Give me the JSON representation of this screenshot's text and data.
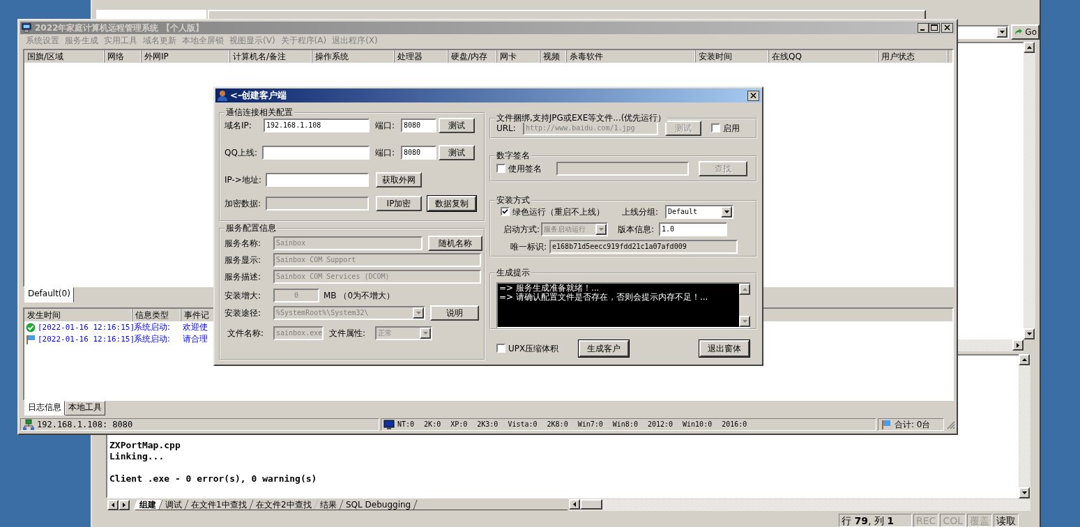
{
  "ide": {
    "go_button": "Go",
    "output": [
      [
        "ZXPortMap.cpp",
        "Linking..."
      ],
      [
        "Client .exe - 0 error(s), 0 warning(s)"
      ]
    ],
    "tabs": [
      {
        "label": "组建",
        "selected": true
      },
      {
        "label": "调试",
        "selected": false
      },
      {
        "label": "在文件1中查找",
        "selected": false
      },
      {
        "label": "在文件2中查找",
        "selected": false
      },
      {
        "label": "结果",
        "selected": false
      },
      {
        "label": "SQL Debugging",
        "selected": false
      }
    ],
    "status": {
      "position": "行 **79**, 列 **1**",
      "indicators": [
        {
          "label": "REC",
          "enabled": false
        },
        {
          "label": "COL",
          "enabled": false
        },
        {
          "label": "覆盖",
          "enabled": false
        },
        {
          "label": "读取",
          "enabled": true
        }
      ]
    }
  },
  "main_window": {
    "title": "2022年家庭计算机远程管理系统 【个人版】",
    "menu": [
      "系统设置",
      "服务生成",
      "实用工具",
      "域名更新",
      "本地全屏锁",
      "视图显示(V)",
      "关于程序(A)",
      "退出程序(X)"
    ],
    "columns": [
      "国旗/区域",
      "网络",
      "外网IP",
      "计算机名/备注",
      "操作系统",
      "处理器",
      "硬盘/内存",
      "网卡",
      "视频",
      "杀毒软件",
      "安装时间",
      "在线QQ",
      "用户状态"
    ],
    "group_tabs": [
      {
        "label": "Default(0)",
        "selected": true
      }
    ],
    "log_columns": [
      "发生时间",
      "信息类型",
      "事件记"
    ],
    "log_rows": [
      {
        "kind": "success",
        "time": "[2022-01-16 12:16:15]",
        "type": "系统启动:",
        "event": "欢迎使"
      },
      {
        "kind": "notice",
        "time": "[2022-01-16 12:16:15]",
        "type": "系统启动:",
        "event": "请合理"
      }
    ],
    "bottom_tabs": [
      {
        "label": "日志信息",
        "selected": true
      },
      {
        "label": "本地工具",
        "selected": false
      }
    ],
    "status": {
      "address": "192.168.1.108: 8080",
      "os_counts": [
        "NT:0",
        "2K:0",
        "XP:0",
        "2K3:0",
        "Vista:0",
        "2K8:0",
        "Win7:0",
        "Win8:0",
        "2012:0",
        "Win10:0",
        "2016:0"
      ],
      "total": "合计: 0台"
    }
  },
  "dialog": {
    "title": "<-创建客户端",
    "connection": {
      "title": "通信连接相关配置",
      "domain": {
        "label": "域名IP:",
        "value": "192.168.1.108"
      },
      "domain_port": {
        "label": "端口:",
        "value": "8080"
      },
      "domain_test": {
        "label": "测试"
      },
      "qq": {
        "label": "QQ上线:"
      },
      "qq_port": {
        "label": "端口:",
        "value": "8080"
      },
      "qq_test": {
        "label": "测试"
      },
      "ip_lookup": {
        "label": "IP->地址:"
      },
      "ip_lookup_button": {
        "label": "获取外网"
      },
      "encrypted": {
        "label": "加密数据:",
        "disabled": true
      },
      "encrypt_button": {
        "label": "IP加密"
      },
      "copy_button": {
        "label": "数据复制",
        "default": true
      }
    },
    "service": {
      "title": "服务配置信息",
      "name": {
        "label": "服务名称:",
        "value": "Sainbox",
        "disabled": true
      },
      "random_button": {
        "label": "随机名称"
      },
      "display": {
        "label": "服务显示:",
        "value": "Sainbox COM Support",
        "disabled": true
      },
      "description": {
        "label": "服务描述:",
        "value": "Sainbox COM Services (DCOM)",
        "disabled": true
      },
      "size": {
        "label": "安装增大:",
        "value": "0",
        "disabled": true
      },
      "size_note": "MB （0为不增大）",
      "path": {
        "label": "安装途径:",
        "value": "%SystemRoot%\\System32\\",
        "disabled": true
      },
      "path_button": {
        "label": "说明"
      },
      "file_name": {
        "label": "文件名称:",
        "value": "sainbox.exe",
        "disabled": true
      },
      "file_attr": {
        "label": "文件属性:",
        "value": "正常",
        "disabled": true
      }
    },
    "bind": {
      "title": "文件捆绑,支持JPG或EXE等文件...(优先运行）",
      "url": {
        "label": "URL:",
        "value": "http://www.baidu.com/1.jpg",
        "disabled": true
      },
      "test": {
        "label": "测试",
        "disabled": true
      },
      "enable": {
        "label": "启用",
        "checked": false
      }
    },
    "sign": {
      "title": "数字签名",
      "use": {
        "label": "使用签名",
        "checked": false
      },
      "field": {
        "disabled": true
      },
      "find": {
        "label": "查找",
        "disabled": true
      }
    },
    "install": {
      "title": "安装方式",
      "green": {
        "label": "绿色运行（重启不上线）",
        "checked": true
      },
      "group": {
        "label": "上线分组:",
        "value": "Default"
      },
      "start": {
        "label": "启动方式:",
        "value": "服务启动运行",
        "disabled": true
      },
      "version": {
        "label": "版本信息:",
        "value": "1.0"
      },
      "uid": {
        "label": "唯一标识:",
        "value": "e168b71d5eecc919fdd21c1a07afd009",
        "read_only": true
      }
    },
    "hints": {
      "title": "生成提示",
      "lines": [
        "=> 服务生成准备就绪！...",
        "=> 请确认配置文件是否存在，否则会提示内存不足！..."
      ]
    },
    "upx": {
      "label": "UPX压缩体积",
      "checked": false
    },
    "build_button": {
      "label": "生成客户"
    },
    "exit_button": {
      "label": "退出窗体"
    }
  }
}
